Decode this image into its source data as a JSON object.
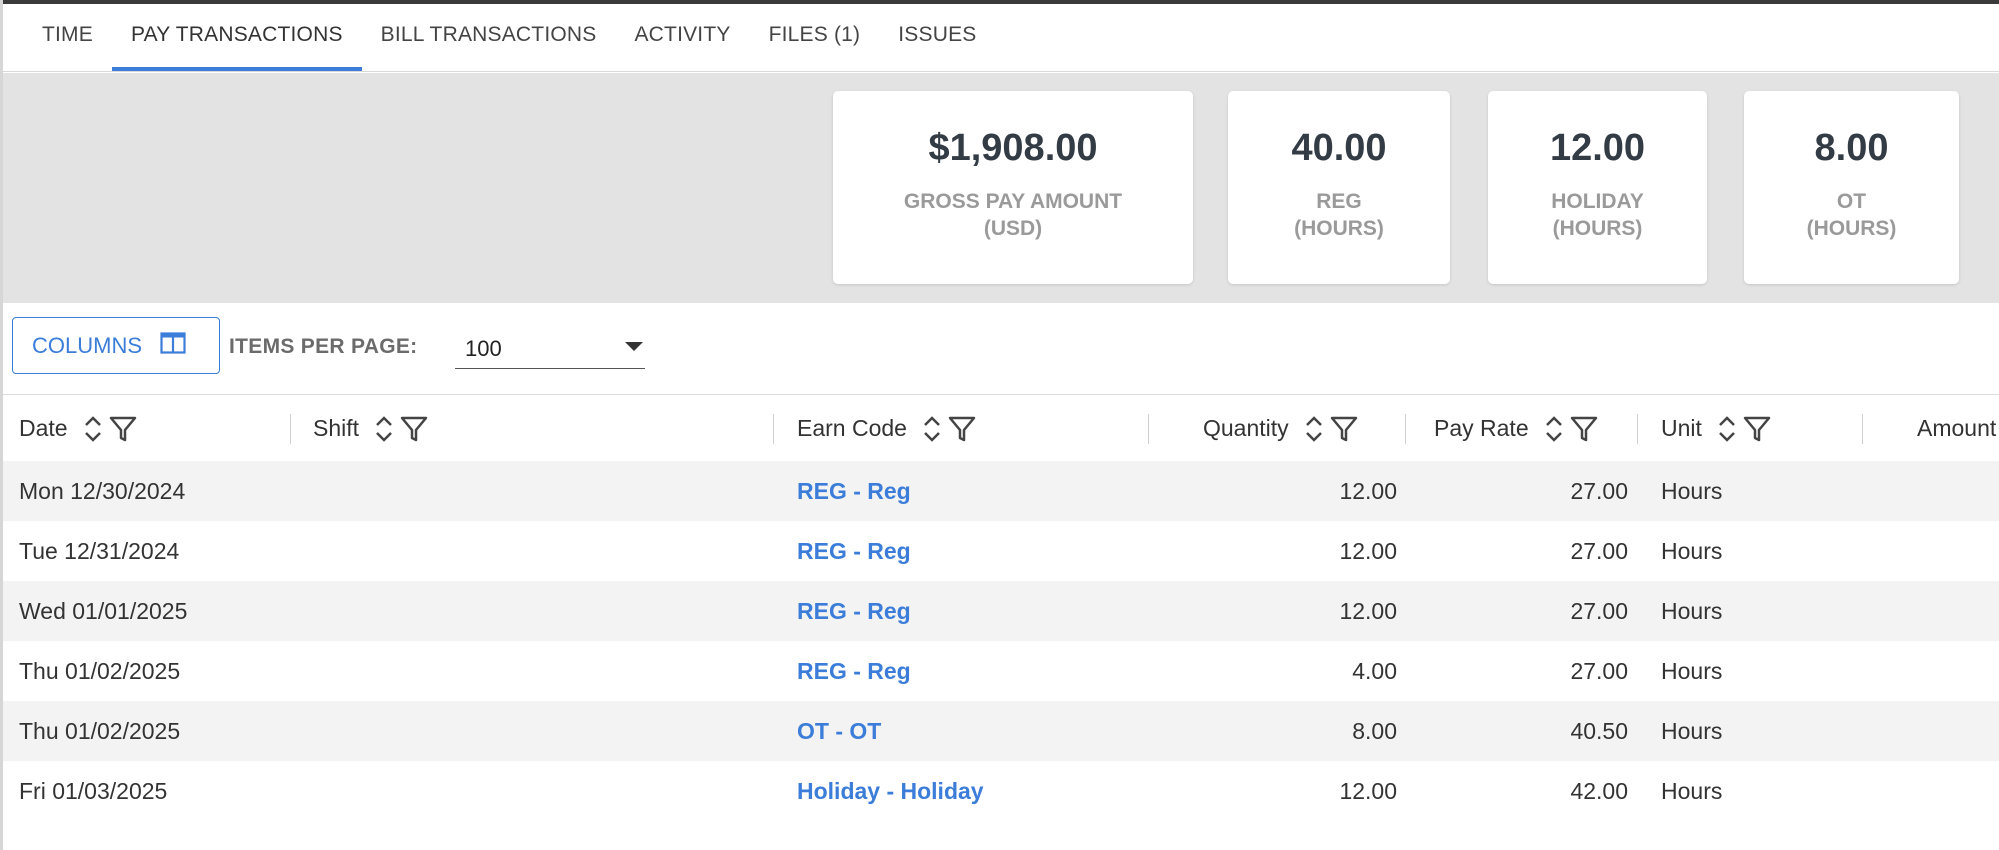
{
  "tabs": [
    {
      "label": "TIME"
    },
    {
      "label": "PAY TRANSACTIONS",
      "active": true
    },
    {
      "label": "BILL TRANSACTIONS"
    },
    {
      "label": "ACTIVITY"
    },
    {
      "label": "FILES (1)"
    },
    {
      "label": "ISSUES"
    }
  ],
  "summary": {
    "gross": {
      "value": "$1,908.00",
      "label": "GROSS PAY AMOUNT\n(USD)"
    },
    "reg": {
      "value": "40.00",
      "label": "REG\n(HOURS)"
    },
    "holiday": {
      "value": "12.00",
      "label": "HOLIDAY\n(HOURS)"
    },
    "ot": {
      "value": "8.00",
      "label": "OT\n(HOURS)"
    }
  },
  "toolbar": {
    "columns_label": "COLUMNS",
    "items_per_page_label": "ITEMS PER PAGE:",
    "items_per_page_value": "100"
  },
  "table": {
    "headers": {
      "date": "Date",
      "shift": "Shift",
      "earn_code": "Earn Code",
      "quantity": "Quantity",
      "pay_rate": "Pay Rate",
      "unit": "Unit",
      "amount": "Amount"
    },
    "rows": [
      {
        "date": "Mon 12/30/2024",
        "shift": "",
        "earn_code": "REG - Reg",
        "quantity": "12.00",
        "pay_rate": "27.00",
        "unit": "Hours"
      },
      {
        "date": "Tue 12/31/2024",
        "shift": "",
        "earn_code": "REG - Reg",
        "quantity": "12.00",
        "pay_rate": "27.00",
        "unit": "Hours"
      },
      {
        "date": "Wed 01/01/2025",
        "shift": "",
        "earn_code": "REG - Reg",
        "quantity": "12.00",
        "pay_rate": "27.00",
        "unit": "Hours"
      },
      {
        "date": "Thu 01/02/2025",
        "shift": "",
        "earn_code": "REG - Reg",
        "quantity": "4.00",
        "pay_rate": "27.00",
        "unit": "Hours"
      },
      {
        "date": "Thu 01/02/2025",
        "shift": "",
        "earn_code": "OT - OT",
        "quantity": "8.00",
        "pay_rate": "40.50",
        "unit": "Hours"
      },
      {
        "date": "Fri 01/03/2025",
        "shift": "",
        "earn_code": "Holiday - Holiday",
        "quantity": "12.00",
        "pay_rate": "42.00",
        "unit": "Hours"
      }
    ]
  },
  "colors": {
    "accent": "#3b7dd8",
    "summary_bg": "#e3e3e3",
    "row_alt": "#f3f3f3"
  },
  "icons": {
    "sort": "sort-icon",
    "filter": "filter-icon",
    "columns": "columns-icon",
    "dropdown": "chevron-down-icon"
  }
}
